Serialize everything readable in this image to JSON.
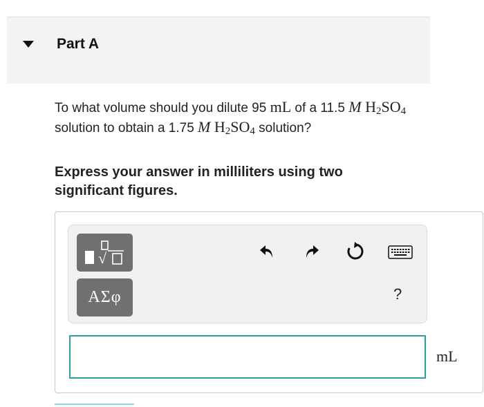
{
  "part": {
    "title": "Part A"
  },
  "question": {
    "text_1": "To what volume should you dilute 95 ",
    "volume_unit": "mL",
    "text_2": " of a 11.5 ",
    "molarity_symbol_1": "M",
    "compound_1_main": "H",
    "compound_1_sub1": "2",
    "compound_1_mid": "SO",
    "compound_1_sub2": "4",
    "text_3": " solution to obtain a 1.75 ",
    "molarity_symbol_2": "M",
    "compound_2_main": "H",
    "compound_2_sub1": "2",
    "compound_2_mid": "SO",
    "compound_2_sub2": "4",
    "text_4": " solution?"
  },
  "instruction": "Express your answer in milliliters using two significant figures.",
  "toolbar": {
    "templates_icon": "fraction-root-template-icon",
    "greek_label": "ΑΣφ",
    "undo_icon": "undo-icon",
    "redo_icon": "redo-icon",
    "reset_icon": "reset-icon",
    "keyboard_icon": "keyboard-icon",
    "help_label": "?"
  },
  "answer": {
    "value": "",
    "unit": "mL"
  },
  "colors": {
    "header_bg": "#f3f3f3",
    "input_border": "#2a9fa7",
    "tool_button": "#707070"
  }
}
